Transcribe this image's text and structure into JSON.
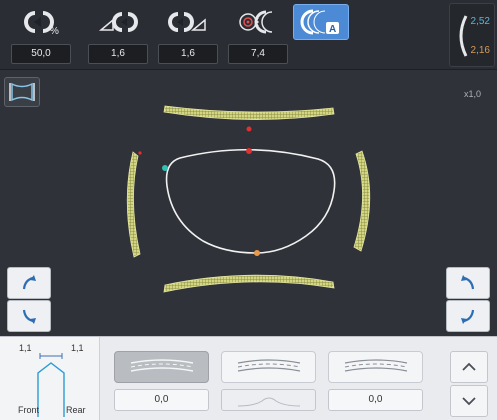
{
  "toolbar": {
    "tools": [
      {
        "name": "position-percent-tool",
        "icon": "lens-position-percent-icon",
        "value": "50,0"
      },
      {
        "name": "front-bevel-tool",
        "icon": "front-bevel-icon",
        "value": "1,6"
      },
      {
        "name": "rear-bevel-tool",
        "icon": "rear-bevel-icon",
        "value": "1,6"
      },
      {
        "name": "curve-tool",
        "icon": "lens-curve-target-icon",
        "value": "7,4"
      },
      {
        "name": "auto-bevel-tool",
        "icon": "auto-bevel-icon",
        "badge": "A"
      }
    ],
    "side_values": {
      "top": "2,52",
      "bottom": "2,16"
    }
  },
  "canvas": {
    "zoom": "x1,0",
    "colors": {
      "bevel": "#d9dc8a",
      "shape": "#f2f2f2",
      "marker_red": "#e0302f",
      "marker_teal": "#2fc1b4",
      "marker_orange": "#e89a4c"
    }
  },
  "profile": {
    "left_value": "1,1",
    "right_value": "1,1",
    "front_label": "Front",
    "rear_label": "Rear"
  },
  "lens_options": [
    {
      "name": "bevel-option-1",
      "value": "0,0",
      "selected": true
    },
    {
      "name": "bevel-option-2",
      "value": "",
      "selected": false
    },
    {
      "name": "bevel-option-3",
      "value": "0,0",
      "selected": false
    }
  ],
  "icons": {
    "rotate_up": "rotate-up-icon",
    "rotate_down": "rotate-down-icon",
    "chevron_up": "chevron-up-icon",
    "chevron_down": "chevron-down-icon"
  }
}
